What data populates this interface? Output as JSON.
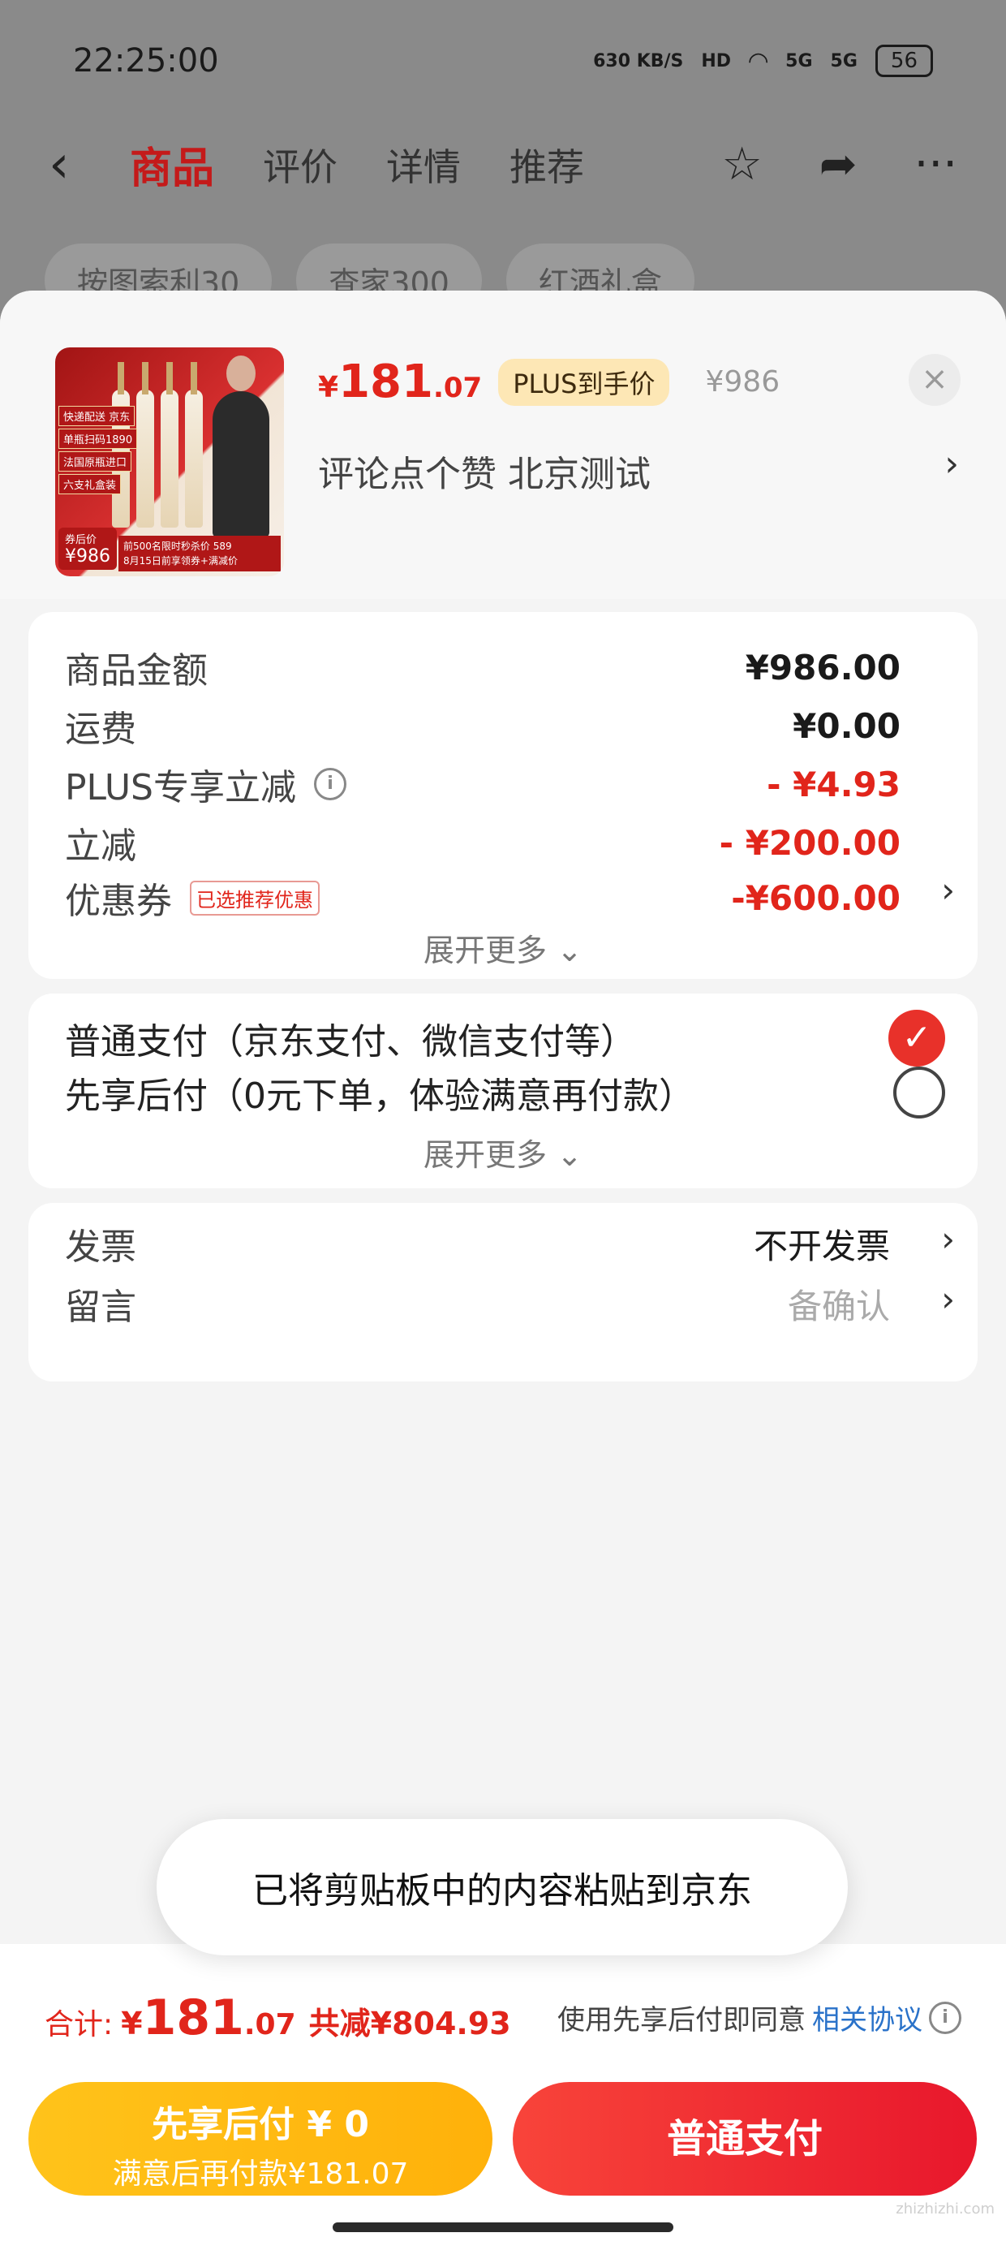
{
  "status_bar": {
    "time": "22:25:00",
    "net_speed": "630 KB/S",
    "hd": "HD",
    "signal1": "5G",
    "signal2": "5G",
    "battery": "56"
  },
  "nav": {
    "tabs": [
      "商品",
      "评价",
      "详情",
      "推荐"
    ],
    "active_tab": "商品"
  },
  "background_chips": [
    "按图索利30",
    "查家300",
    "红酒礼盒"
  ],
  "product": {
    "image_tags": [
      "快递配送 京东",
      "单瓶扫码1890",
      "法国原瓶进口",
      "六支礼盒装"
    ],
    "image_price_label": "券后价",
    "image_price": "¥986",
    "image_band": "前500名限时秒杀价 589",
    "image_band_sub": "8月15日前享领券+满减价",
    "price_symbol": "¥",
    "price_int": "181",
    "price_dec": ".07",
    "plus_badge": "PLUS到手价",
    "original_price": "¥986",
    "spec": "评论点个赞  北京测试"
  },
  "costs": [
    {
      "label": "商品金额",
      "value": "¥986.00",
      "style": "normal"
    },
    {
      "label": "运费",
      "value": "¥0.00",
      "style": "normal"
    },
    {
      "label": "PLUS专享立减",
      "value": "- ¥4.93",
      "style": "red"
    },
    {
      "label": "立减",
      "value": "- ¥200.00",
      "style": "red"
    },
    {
      "label": "优惠券",
      "tag": "已选推荐优惠",
      "value": "-¥600.00",
      "style": "red"
    }
  ],
  "expand_more": "展开更多",
  "payment_options": [
    {
      "label": "普通支付（京东支付、微信支付等）",
      "selected": true
    },
    {
      "label": "先享后付（0元下单，体验满意再付款）",
      "selected": false
    }
  ],
  "extras": [
    {
      "label": "发票",
      "value": "不开发票"
    },
    {
      "label": "留言",
      "value": "备确认"
    }
  ],
  "toast": "已将剪贴板中的内容粘贴到京东",
  "summary": {
    "label": "合计:",
    "symbol": "¥",
    "int": "181",
    "dec": ".07",
    "saved": "共减¥804.93",
    "agree_prefix": "使用先享后付即同意",
    "agree_link": "相关协议"
  },
  "buttons": {
    "later_title": "先享后付 ¥ 0",
    "later_sub": "满意后再付款¥181.07",
    "pay": "普通支付"
  },
  "watermark": "zhizhizhi.com",
  "colors": {
    "accent_red": "#e1251b",
    "plus_gold": "#fde7b5",
    "later_btn": "#ffb10a",
    "link_blue": "#2a72c9"
  }
}
